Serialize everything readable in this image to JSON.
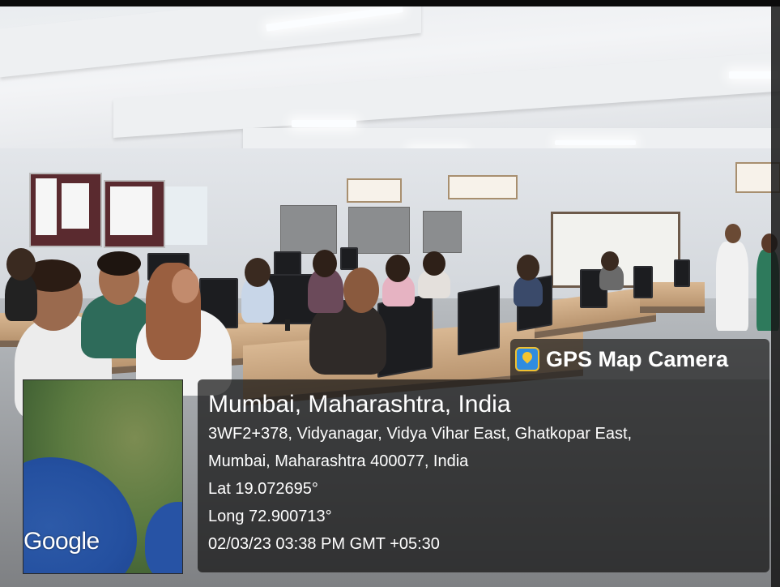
{
  "overlay": {
    "app_name": "GPS Map Camera",
    "location_title": "Mumbai, Maharashtra, India",
    "address_line1": "3WF2+378, Vidyanagar, Vidya Vihar East, Ghatkopar East,",
    "address_line2": "Mumbai, Maharashtra 400077, India",
    "latitude": "Lat 19.072695°",
    "longitude": "Long 72.900713°",
    "timestamp": "02/03/23 03:38 PM GMT +05:30",
    "map_logo": "Google",
    "icon": "map-pin-icon"
  },
  "colors": {
    "panel": "#141414",
    "sea": "#2450a0",
    "land": "#5b7a40",
    "desk": "#c9a57f"
  }
}
